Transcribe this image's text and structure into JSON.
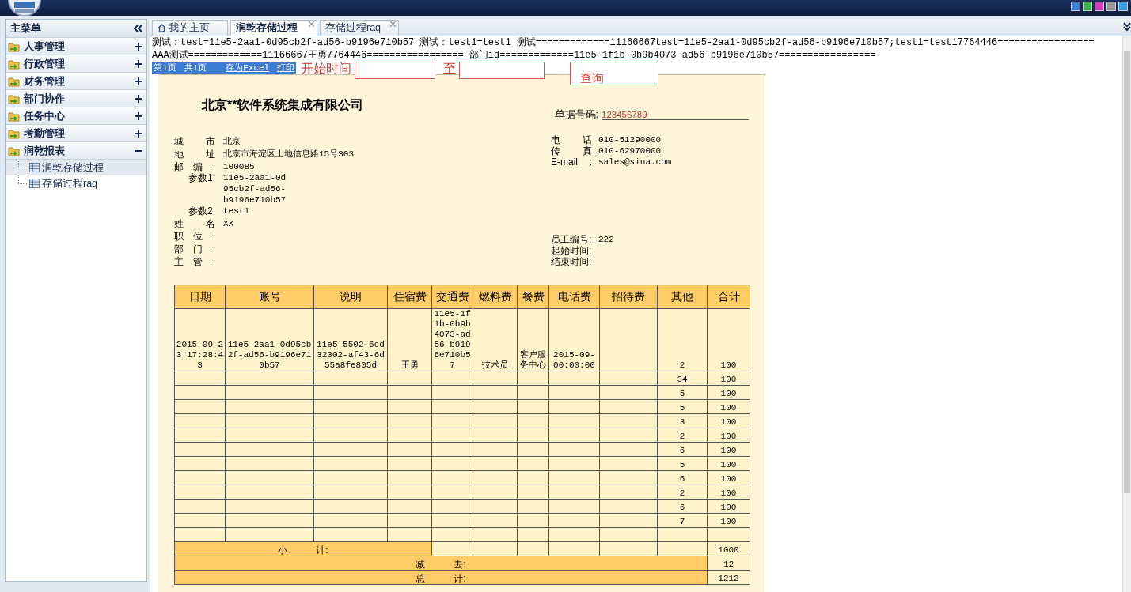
{
  "sidebar": {
    "title": "主菜单",
    "groups": [
      {
        "label": "人事管理",
        "expanded": false
      },
      {
        "label": "行政管理",
        "expanded": false
      },
      {
        "label": "财务管理",
        "expanded": false
      },
      {
        "label": "部门协作",
        "expanded": false
      },
      {
        "label": "任务中心",
        "expanded": false
      },
      {
        "label": "考勤管理",
        "expanded": false
      },
      {
        "label": "润乾报表",
        "expanded": true,
        "children": [
          {
            "label": "润乾存储过程",
            "selected": true
          },
          {
            "label": "存储过程raq",
            "selected": false
          }
        ]
      }
    ]
  },
  "tabs": [
    {
      "label": "我的主页",
      "kind": "home",
      "selected": false
    },
    {
      "label": "润乾存储过程",
      "kind": "page",
      "selected": true
    },
    {
      "label": "存储过程raq",
      "kind": "page",
      "selected": false
    }
  ],
  "debug_lines": [
    "测试：test=11e5-2aa1-0d95cb2f-ad56-b9196e710b57 测试：test1=test1 测试=============11166667test=11e5-2aa1-0d95cb2f-ad56-b9196e710b57;test1=test17764446=================",
    "AAA测试=============11166667王勇7764446================= 部门id=============11e5-1f1b-0b9b4073-ad56-b9196e710b57================="
  ],
  "toolbar": {
    "page": "第1页",
    "pages": "共1页",
    "export": "存为Excel",
    "print": "打印",
    "start_label": "开始时间",
    "to_label": "至",
    "query": "查询"
  },
  "report": {
    "title": "北京**软件系统集成有限公司",
    "doc_no_label": "单据号码:",
    "doc_no": "123456789",
    "left_fields": [
      {
        "label": "城市",
        "value": "北京",
        "kind": "spread"
      },
      {
        "label": "地址",
        "value": "北京市海淀区上地信息路15号303",
        "kind": "spread"
      },
      {
        "label": "邮编:",
        "value": "100085",
        "kind": "spread"
      },
      {
        "label": "参数1:",
        "value": "11e5-2aa1-0d95cb2f-ad56-b9196e710b57",
        "kind": "param"
      },
      {
        "label": "参数2:",
        "value": "test1",
        "kind": "param"
      },
      {
        "label": "姓名",
        "value": "XX",
        "kind": "spread"
      },
      {
        "label": "职位:",
        "kind": "spread"
      },
      {
        "label": "部门:",
        "kind": "spread"
      },
      {
        "label": "主管:",
        "kind": "spread"
      }
    ],
    "right_fields": [
      {
        "label": "电话",
        "value": "010-51290000",
        "kind": "spread"
      },
      {
        "label": "传真",
        "value": "010-62970000",
        "kind": "spread"
      },
      {
        "label": "E-mail :",
        "value": "sales@sina.com",
        "kind": "spread"
      },
      {
        "label": "员工编号:",
        "value": "222",
        "kind": "plain"
      },
      {
        "label": "起始时间:",
        "kind": "plain"
      },
      {
        "label": "结束时间:",
        "kind": "plain"
      }
    ],
    "table": {
      "columns": [
        "日期",
        "账号",
        "说明",
        "住宿费",
        "交通费",
        "燃料费",
        "餐费",
        "电话费",
        "招待费",
        "其他",
        "合计"
      ],
      "rows": [
        [
          "2015-09-23 17:28:43",
          "11e5-2aa1-0d95cb2f-ad56-b9196e710b57",
          "11e5-5502-6cd32302-af43-6d55a8fe805d",
          "王勇",
          "11e5-1f1b-0b9b4073-ad56-b9196e710b57",
          "技术员",
          "客户服务中心",
          "2015-09- 00:00:00",
          "",
          "2",
          "100"
        ],
        [
          "",
          "",
          "",
          "",
          "",
          "",
          "",
          "",
          "",
          "34",
          "100"
        ],
        [
          "",
          "",
          "",
          "",
          "",
          "",
          "",
          "",
          "",
          "5",
          "100"
        ],
        [
          "",
          "",
          "",
          "",
          "",
          "",
          "",
          "",
          "",
          "5",
          "100"
        ],
        [
          "",
          "",
          "",
          "",
          "",
          "",
          "",
          "",
          "",
          "3",
          "100"
        ],
        [
          "",
          "",
          "",
          "",
          "",
          "",
          "",
          "",
          "",
          "2",
          "100"
        ],
        [
          "",
          "",
          "",
          "",
          "",
          "",
          "",
          "",
          "",
          "6",
          "100"
        ],
        [
          "",
          "",
          "",
          "",
          "",
          "",
          "",
          "",
          "",
          "5",
          "100"
        ],
        [
          "",
          "",
          "",
          "",
          "",
          "",
          "",
          "",
          "",
          "6",
          "100"
        ],
        [
          "",
          "",
          "",
          "",
          "",
          "",
          "",
          "",
          "",
          "2",
          "100"
        ],
        [
          "",
          "",
          "",
          "",
          "",
          "",
          "",
          "",
          "",
          "6",
          "100"
        ],
        [
          "",
          "",
          "",
          "",
          "",
          "",
          "",
          "",
          "",
          "7",
          "100"
        ],
        [
          "",
          "",
          "",
          "",
          "",
          "",
          "",
          "",
          "",
          "",
          ""
        ]
      ],
      "subtotal_label": "小　　　计:",
      "subtotal": "1000",
      "minus_label": "减　　　去:",
      "minus": "12",
      "total_label": "总　　　计:",
      "total": "1212"
    }
  }
}
